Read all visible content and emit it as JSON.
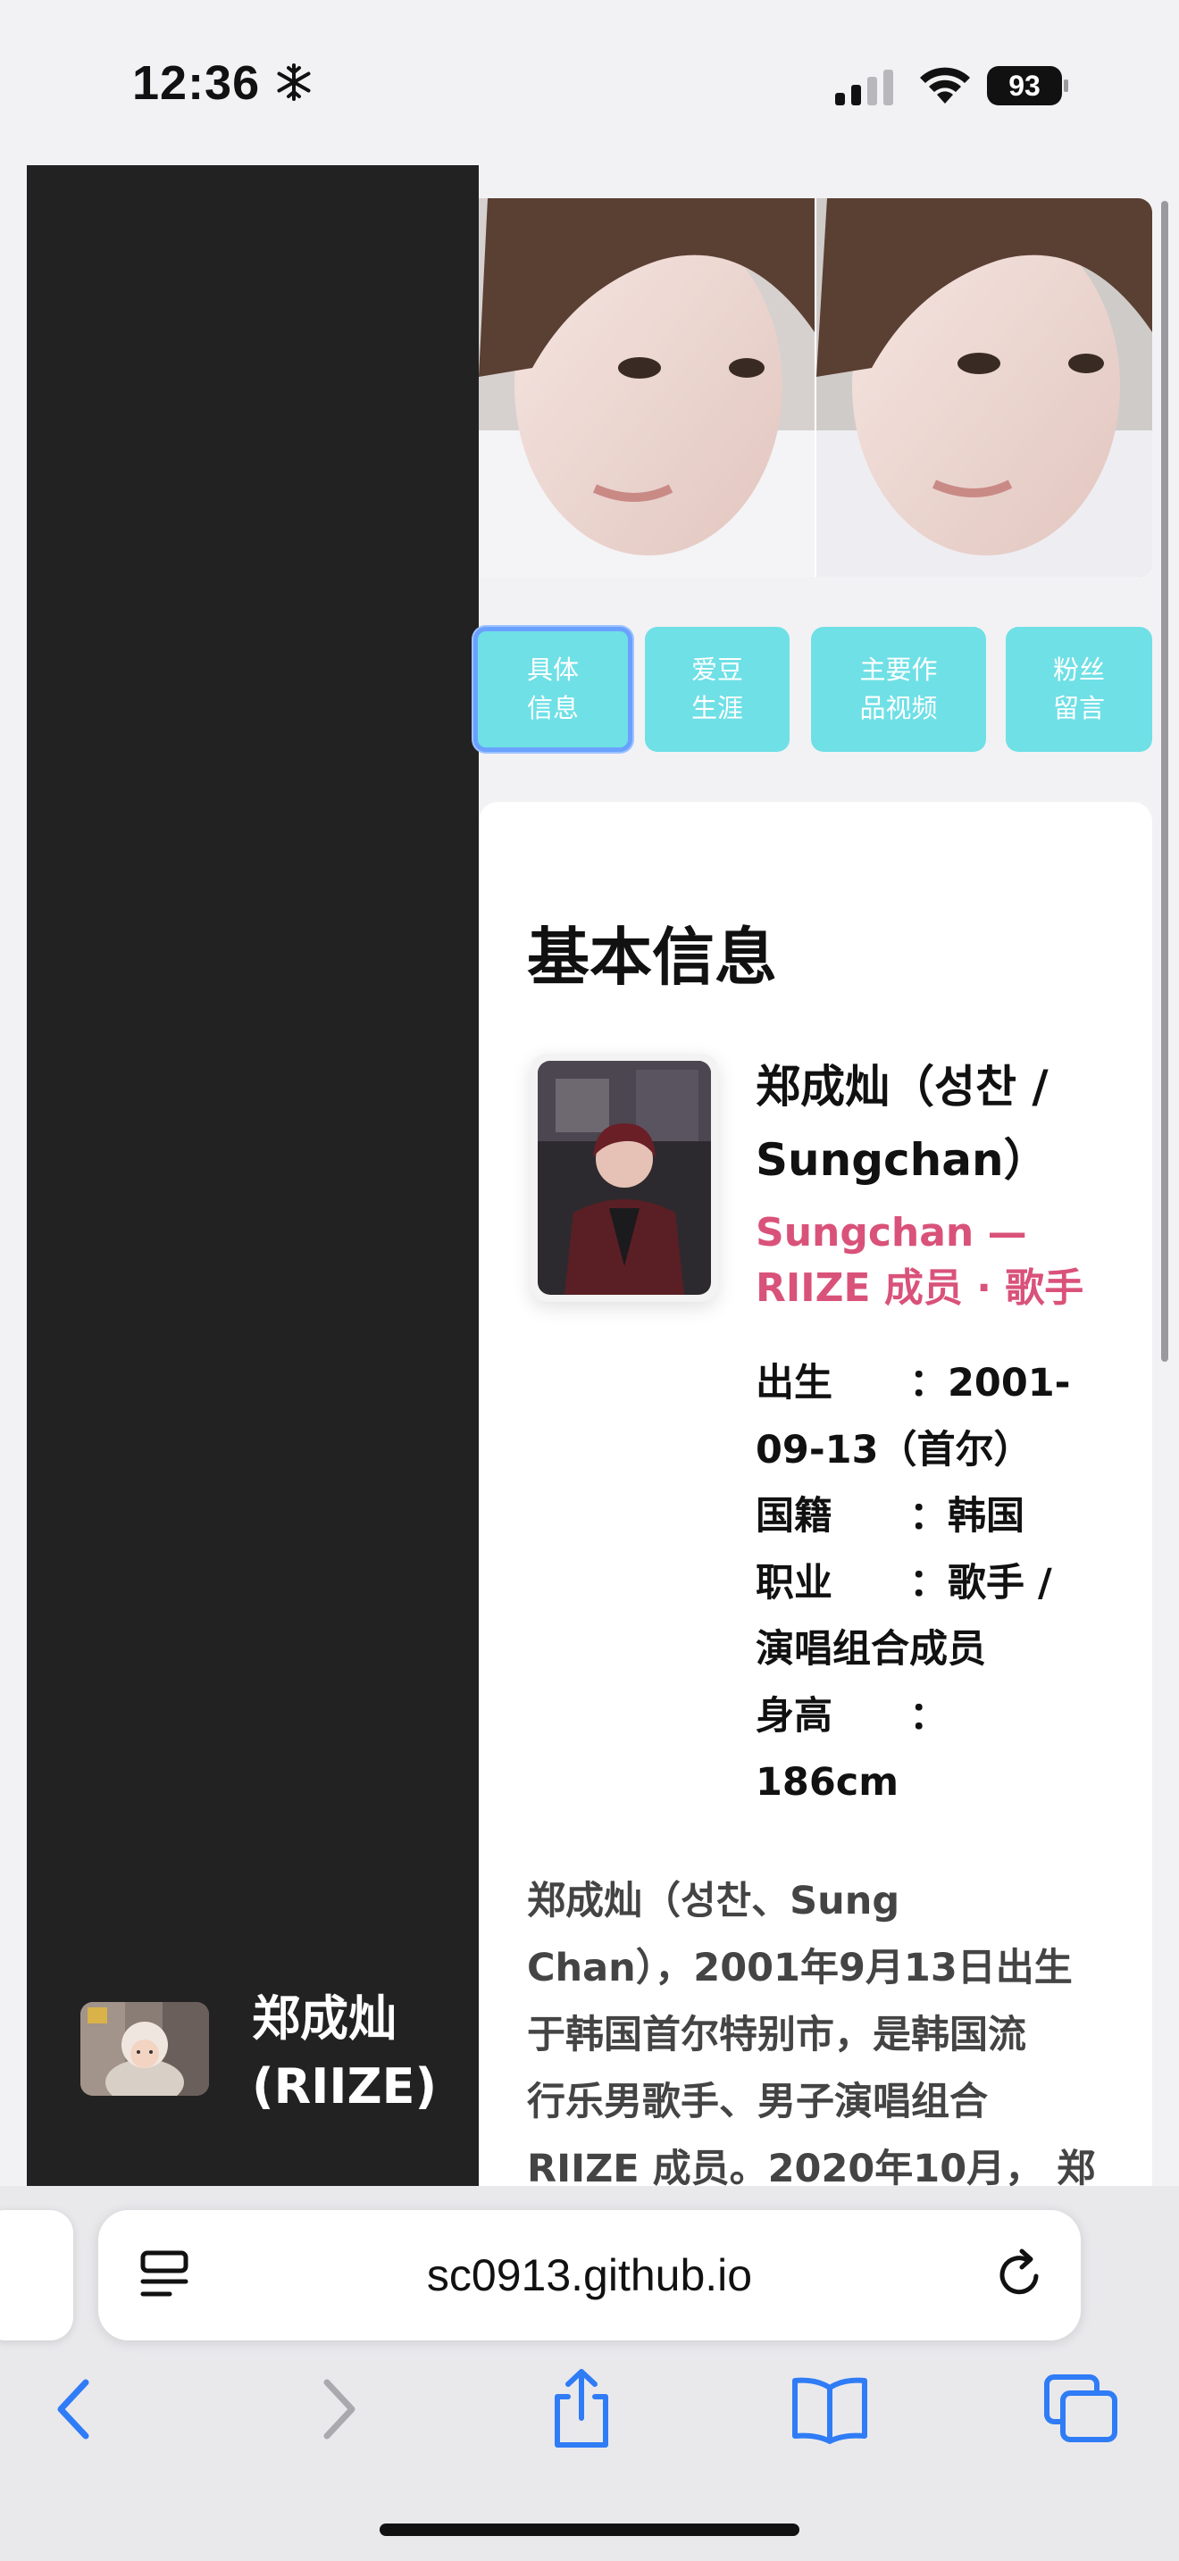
{
  "status_bar": {
    "time": "12:36",
    "battery": "93"
  },
  "sidebar": {
    "title_line1": "郑成灿",
    "title_line2": "(RIIZE)"
  },
  "tabs": [
    {
      "line1": "具体",
      "line2": "信息",
      "active": true
    },
    {
      "line1": "爱豆",
      "line2": "生涯",
      "active": false
    },
    {
      "line1": "主要作",
      "line2": "品视频",
      "active": false
    },
    {
      "line1": "粉丝",
      "line2": "留言",
      "active": false
    }
  ],
  "card": {
    "title": "基本信息",
    "name_line1": "郑成灿（성찬 /",
    "name_line2": "Sungchan）",
    "subtitle_line1": "Sungchan —",
    "subtitle_line2": "RIIZE 成员 · 歌手",
    "facts": [
      "出生　　：2001-",
      "09-13（首尔）",
      "国籍　　：韩国",
      "职业　　：歌手 /",
      "演唱组合成员",
      "身高　　：",
      "186cm"
    ],
    "bio": [
      "郑成灿（성찬、Sung",
      "Chan），2001年9月13日出生",
      "于韩国首尔特别市，是韩国流",
      "行乐男歌手、男子演唱组合",
      "RIIZE 成员。2020年10月， 郑"
    ]
  },
  "browser": {
    "url": "sc0913.github.io"
  },
  "colors": {
    "accent_tab": "#6fe0e6",
    "tab_focus": "#6aa1ff",
    "subtitle_pink": "#d9527a",
    "sidebar_bg": "#222222"
  },
  "icons": [
    "snowflake-icon",
    "cellular-signal-icon",
    "wifi-icon",
    "battery-icon",
    "page-menu-icon",
    "reload-icon",
    "back-icon",
    "forward-icon",
    "share-icon",
    "bookmarks-icon",
    "tabs-icon"
  ]
}
